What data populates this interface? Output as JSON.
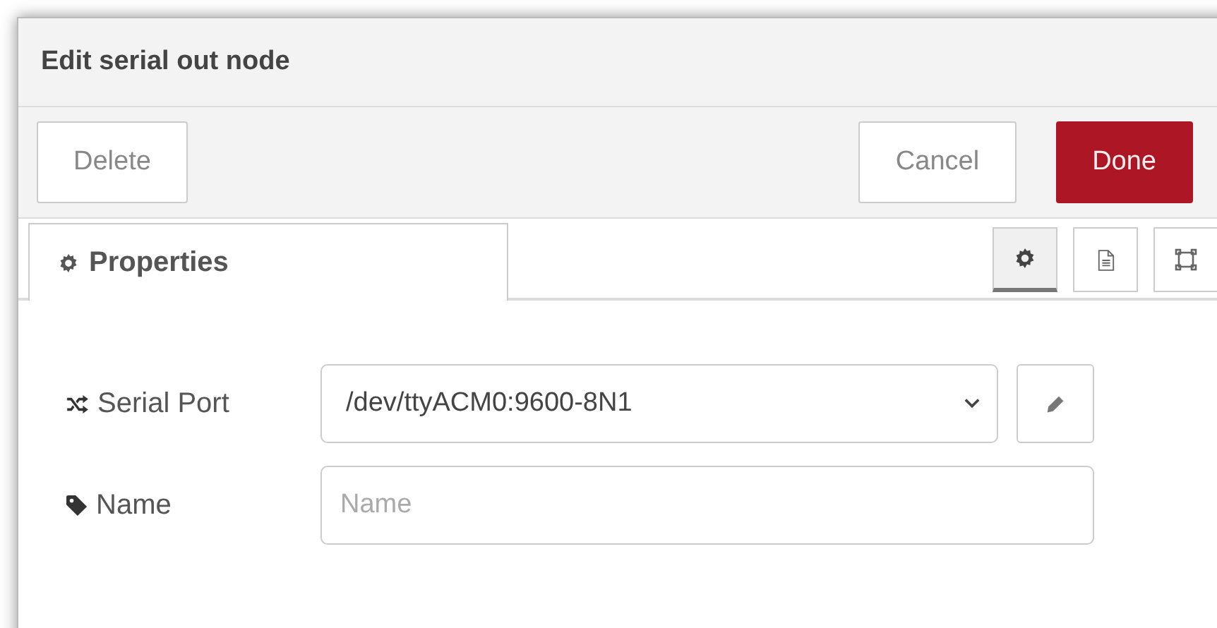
{
  "dialog": {
    "title": "Edit serial out node"
  },
  "buttons": [
    {
      "label": "Delete",
      "kind": "plain"
    },
    {
      "label": "Cancel",
      "kind": "plain"
    },
    {
      "label": "Done",
      "kind": "primary"
    }
  ],
  "tab": {
    "label": "Properties",
    "selected": true
  },
  "side_tabs": [
    {
      "kind": "settings",
      "selected": true
    },
    {
      "kind": "document",
      "selected": false
    },
    {
      "kind": "frame",
      "selected": false
    }
  ],
  "fields": [
    {
      "label": "Serial Port",
      "kind": "select",
      "value": "/dev/ttyACM0:9600-8N1"
    },
    {
      "label": "Name",
      "kind": "text",
      "placeholder": "Name"
    }
  ]
}
